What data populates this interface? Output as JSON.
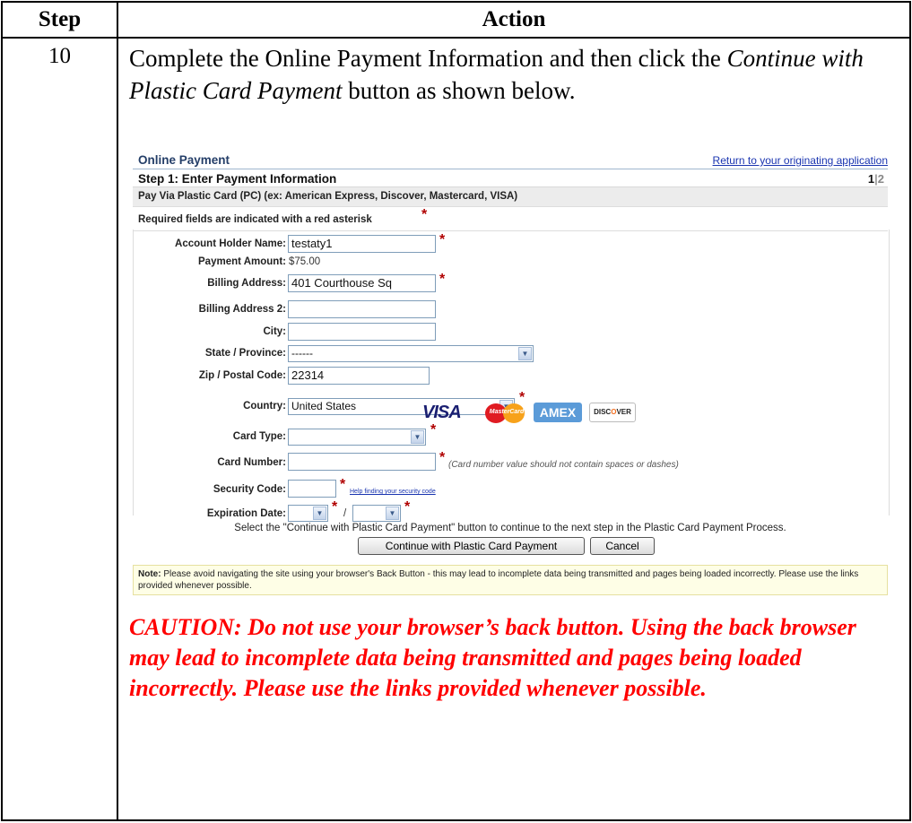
{
  "table": {
    "header_step": "Step",
    "header_action": "Action",
    "step_number": "10",
    "instruction_part1": "Complete the Online Payment Information and then click the ",
    "instruction_italic": "Continue with Plastic Card Payment",
    "instruction_part2": " button as shown below.",
    "caution": "CAUTION:  Do not use your browser’s back button.  Using the back browser may lead to incomplete data being transmitted and pages being loaded incorrectly.  Please use the links provided whenever possible."
  },
  "payment": {
    "title": "Online Payment",
    "return_link": "Return to your originating application",
    "step_title": "Step 1: Enter Payment Information",
    "page_current": "1",
    "page_sep": "|",
    "page_next": "2",
    "pay_via": "Pay Via Plastic Card (PC) (ex: American Express, Discover, Mastercard, VISA)",
    "required_note": "Required fields are indicated with a red asterisk",
    "asterisk": "*",
    "labels": {
      "account_holder": "Account Holder Name:",
      "payment_amount": "Payment Amount:",
      "billing_address": "Billing Address:",
      "billing_address2": "Billing Address 2:",
      "city": "City:",
      "state": "State / Province:",
      "zip": "Zip / Postal Code:",
      "country": "Country:",
      "card_type": "Card Type:",
      "card_number": "Card Number:",
      "security_code": "Security Code:",
      "expiration": "Expiration Date:"
    },
    "values": {
      "account_holder": "testaty1",
      "payment_amount": "$75.00",
      "billing_address": "401 Courthouse Sq",
      "billing_address2": "",
      "city": "",
      "state": "------",
      "zip": "22314",
      "country": "United States",
      "card_type": "",
      "card_number": "",
      "security_code": "",
      "exp_month": "",
      "exp_year": ""
    },
    "card_number_hint": "(Card number value should not contain spaces or dashes)",
    "security_help_link": "Help finding your security code",
    "exp_separator": "/",
    "card_logos": {
      "visa": "VISA",
      "mastercard": "MasterCard",
      "amex": "AMEX",
      "discover_a": "DISC",
      "discover_o": "O",
      "discover_b": "VER"
    },
    "select_note": "Select the \"Continue with Plastic Card Payment\" button to continue to the next step in the Plastic Card Payment Process.",
    "continue_button": "Continue with Plastic Card Payment",
    "cancel_button": "Cancel",
    "note_label": "Note:",
    "note_text": " Please avoid navigating the site using your browser's Back Button - this may lead to incomplete data being transmitted and pages being loaded incorrectly. Please use the links provided whenever possible."
  }
}
